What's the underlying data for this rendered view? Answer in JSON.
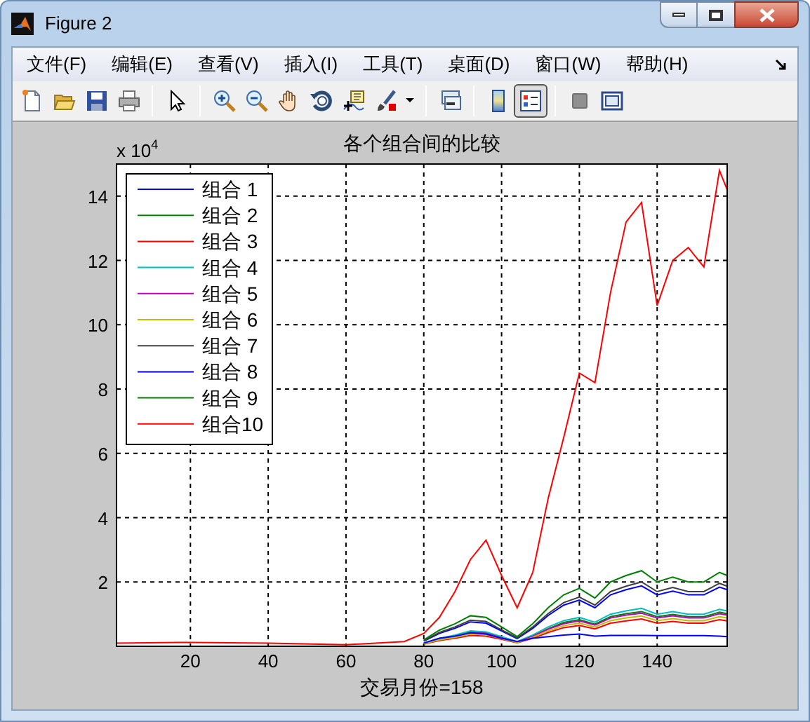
{
  "window": {
    "title": "Figure 2"
  },
  "menu": [
    {
      "label": "文件(F)"
    },
    {
      "label": "编辑(E)"
    },
    {
      "label": "查看(V)"
    },
    {
      "label": "插入(I)"
    },
    {
      "label": "工具(T)"
    },
    {
      "label": "桌面(D)"
    },
    {
      "label": "窗口(W)"
    },
    {
      "label": "帮助(H)"
    }
  ],
  "toolbar": [
    {
      "kind": "new",
      "pressed": false
    },
    {
      "kind": "open",
      "pressed": false
    },
    {
      "kind": "save",
      "pressed": false
    },
    {
      "kind": "print",
      "pressed": false
    },
    {
      "kind": "separator"
    },
    {
      "kind": "pointer",
      "pressed": false
    },
    {
      "kind": "separator"
    },
    {
      "kind": "zoom-in",
      "pressed": false
    },
    {
      "kind": "zoom-out",
      "pressed": false
    },
    {
      "kind": "pan",
      "pressed": false
    },
    {
      "kind": "rotate",
      "pressed": false
    },
    {
      "kind": "data-cursor",
      "pressed": false
    },
    {
      "kind": "brush",
      "pressed": false
    },
    {
      "kind": "caret"
    },
    {
      "kind": "separator"
    },
    {
      "kind": "link",
      "pressed": false
    },
    {
      "kind": "separator"
    },
    {
      "kind": "colorbar",
      "pressed": false
    },
    {
      "kind": "legend",
      "pressed": true
    },
    {
      "kind": "separator"
    },
    {
      "kind": "hide-tools",
      "pressed": false
    },
    {
      "kind": "show-tools",
      "pressed": false
    }
  ],
  "axes": {
    "exponent": "x 10$^{4}$",
    "chart_data": {
      "type": "line",
      "title": "各个组合间的比较",
      "xlabel": "交易月份=158",
      "xlim": [
        1,
        158
      ],
      "ylim": [
        0,
        15
      ],
      "grid": true,
      "legend": true,
      "xticks": [
        20,
        40,
        60,
        80,
        100,
        120,
        140
      ],
      "yticks": [
        2,
        4,
        6,
        8,
        10,
        12,
        14
      ],
      "x": [
        1,
        20,
        40,
        60,
        75,
        80,
        84,
        88,
        92,
        96,
        100,
        104,
        108,
        112,
        116,
        120,
        124,
        128,
        132,
        136,
        140,
        144,
        148,
        152,
        156,
        158
      ],
      "series": [
        {
          "name": "组合 1",
          "color": "#0000ff",
          "values": [
            null,
            null,
            null,
            null,
            null,
            0.16,
            0.4,
            0.56,
            0.76,
            0.72,
            0.48,
            0.24,
            0.56,
            0.96,
            1.28,
            1.44,
            1.2,
            1.6,
            1.76,
            1.88,
            1.6,
            1.72,
            1.6,
            1.6,
            1.84,
            1.76
          ]
        },
        {
          "name": "组合 2",
          "color": "#008000",
          "values": [
            null,
            null,
            null,
            null,
            null,
            0.09,
            0.23,
            0.32,
            0.44,
            0.41,
            0.28,
            0.14,
            0.32,
            0.55,
            0.74,
            0.83,
            0.69,
            0.92,
            1.01,
            1.08,
            0.92,
            0.99,
            0.92,
            0.92,
            1.06,
            1.01
          ]
        },
        {
          "name": "组合 3",
          "color": "#ff0000",
          "values": [
            null,
            null,
            null,
            null,
            null,
            0.07,
            0.18,
            0.25,
            0.34,
            0.32,
            0.22,
            0.11,
            0.25,
            0.43,
            0.58,
            0.65,
            0.54,
            0.72,
            0.79,
            0.85,
            0.72,
            0.77,
            0.72,
            0.72,
            0.83,
            0.79
          ]
        },
        {
          "name": "组合 4",
          "color": "#00bfbf",
          "values": [
            null,
            null,
            null,
            null,
            null,
            0.1,
            0.25,
            0.35,
            0.48,
            0.45,
            0.3,
            0.15,
            0.35,
            0.6,
            0.8,
            0.9,
            0.75,
            1.0,
            1.1,
            1.18,
            1.0,
            1.08,
            1.0,
            1.0,
            1.15,
            1.1
          ]
        },
        {
          "name": "组合 5",
          "color": "#bf00bf",
          "values": [
            null,
            null,
            null,
            null,
            null,
            null,
            null,
            null,
            0.42,
            0.4,
            0.26,
            0.13,
            0.31,
            0.53,
            0.7,
            0.79,
            0.66,
            0.88,
            0.97,
            1.03,
            0.88,
            0.95,
            0.88,
            0.88,
            1.01,
            0.97
          ]
        },
        {
          "name": "组合 6",
          "color": "#bfbf00",
          "values": [
            null,
            null,
            null,
            null,
            null,
            0.08,
            0.2,
            0.28,
            0.38,
            0.36,
            0.24,
            0.12,
            0.28,
            0.48,
            0.64,
            0.72,
            0.6,
            0.8,
            0.88,
            0.94,
            0.8,
            0.86,
            0.8,
            0.8,
            0.92,
            0.88
          ]
        },
        {
          "name": "组合 7",
          "color": "#404040",
          "values": [
            null,
            null,
            null,
            null,
            null,
            0.17,
            0.43,
            0.6,
            0.81,
            0.77,
            0.51,
            0.26,
            0.6,
            1.02,
            1.36,
            1.53,
            1.28,
            1.7,
            1.87,
            2.0,
            1.7,
            1.83,
            1.7,
            1.7,
            1.96,
            1.87
          ]
        },
        {
          "name": "组合 8",
          "color": "#0000ff",
          "values": [
            null,
            null,
            null,
            null,
            null,
            0.1,
            0.25,
            0.32,
            0.42,
            0.38,
            0.25,
            0.15,
            0.25,
            0.3,
            0.35,
            0.38,
            0.32,
            0.34,
            0.34,
            0.34,
            0.33,
            0.33,
            0.33,
            0.33,
            0.32,
            0.3
          ]
        },
        {
          "name": "组合 9",
          "color": "#008000",
          "values": [
            null,
            null,
            null,
            null,
            null,
            0.2,
            0.5,
            0.7,
            0.95,
            0.9,
            0.6,
            0.3,
            0.7,
            1.2,
            1.6,
            1.8,
            1.5,
            2.0,
            2.2,
            2.35,
            2.0,
            2.15,
            2.0,
            2.0,
            2.3,
            2.2
          ]
        },
        {
          "name": "组合10",
          "color": "#ff0000",
          "values": [
            0.1,
            0.12,
            0.1,
            0.05,
            0.15,
            0.4,
            0.9,
            1.7,
            2.7,
            3.3,
            2.2,
            1.2,
            2.3,
            4.6,
            6.5,
            8.5,
            8.2,
            11,
            13.2,
            13.8,
            10.6,
            12,
            12.4,
            11.8,
            14.8,
            14.2
          ]
        }
      ]
    }
  }
}
